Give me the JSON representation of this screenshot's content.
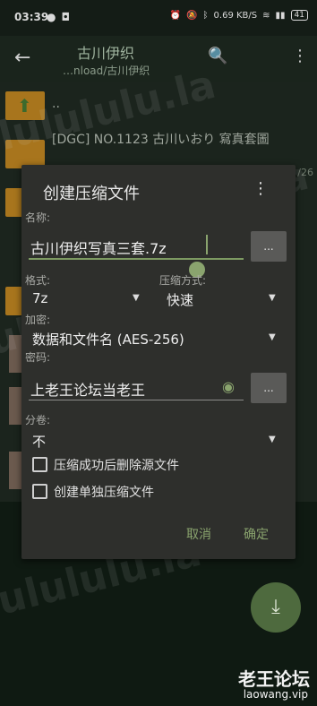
{
  "status": {
    "time": "03:39",
    "network": "0.69 KB/S",
    "battery": "41"
  },
  "header": {
    "title": "古川伊织",
    "path": "…nload/古川伊织"
  },
  "list": [
    {
      "name": "..",
      "type": "up",
      "date": ""
    },
    {
      "name": "[DGC] NO.1123 古川いおり 寫真套圖",
      "type": "folder",
      "date": "/26"
    }
  ],
  "dialog": {
    "title": "创建压缩文件",
    "name_label": "名称:",
    "name_value": "古川伊织写真三套.7z",
    "browse_label": "...",
    "format_label": "格式:",
    "format_value": "7z",
    "compression_label": "压缩方式:",
    "compression_value": "快速",
    "encryption_label": "加密:",
    "encryption_value": "数据和文件名 (AES-256)",
    "password_label": "密码:",
    "password_value": "上老王论坛当老王",
    "password_browse_label": "...",
    "split_label": "分卷:",
    "split_value": "不",
    "option_delete_label": "压缩成功后删除源文件",
    "option_separate_label": "创建单独压缩文件",
    "cancel_label": "取消",
    "ok_label": "确定"
  },
  "fab_icon": "download-icon",
  "watermark": "lulululu.la",
  "brand": {
    "name": "老王论坛",
    "url": "laowang.vip"
  },
  "colors": {
    "accent": "#8aa46e",
    "dialog_bg": "#2e2f2c",
    "folder": "#a8751d"
  }
}
